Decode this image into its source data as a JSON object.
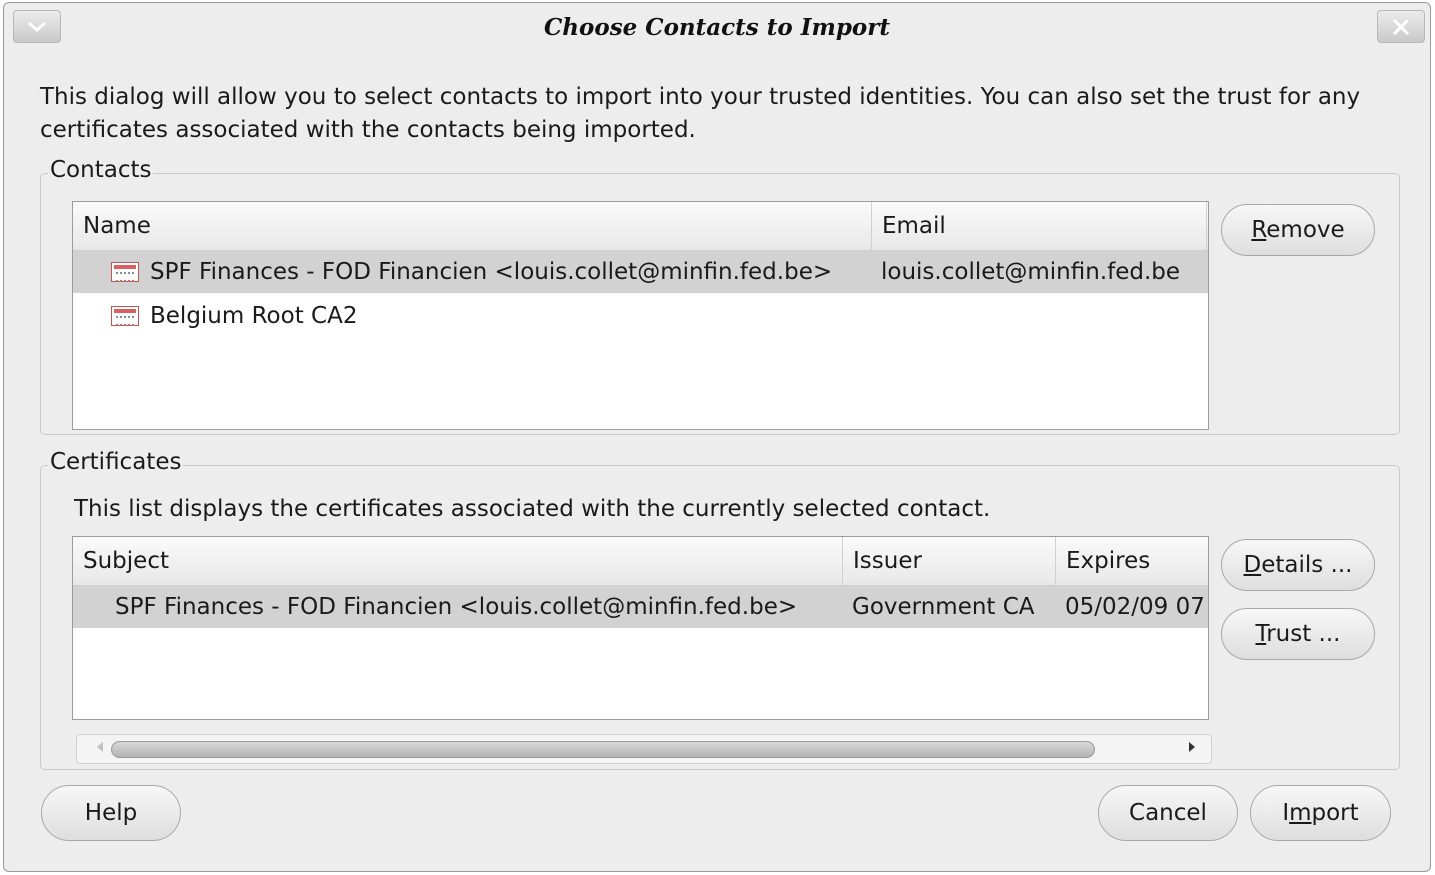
{
  "window": {
    "title": "Choose Contacts to Import"
  },
  "intro": "This dialog will allow you to select contacts to import into your trusted identities. You can also set the trust for any certificates associated with the contacts being imported.",
  "contacts": {
    "group_title": "Contacts",
    "columns": {
      "name": "Name",
      "email": "Email"
    },
    "rows": [
      {
        "name": "SPF Finances - FOD Financien <louis.collet@minfin.fed.be>",
        "email": "louis.collet@minfin.fed.be",
        "selected": true
      },
      {
        "name": "Belgium Root CA2",
        "email": "",
        "selected": false
      }
    ],
    "remove_prefix": "",
    "remove_mnemonic": "R",
    "remove_rest": "emove"
  },
  "certificates": {
    "group_title": "Certificates",
    "description": "This list displays the certificates associated with the currently selected contact.",
    "columns": {
      "subject": "Subject",
      "issuer": "Issuer",
      "expires": "Expires"
    },
    "rows": [
      {
        "subject": "SPF Finances - FOD Financien <louis.collet@minfin.fed.be>",
        "issuer": "Government CA",
        "expires": "05/02/09 07",
        "selected": true
      }
    ],
    "details_mnemonic": "D",
    "details_rest": "etails ...",
    "trust_mnemonic": "T",
    "trust_rest": "rust ..."
  },
  "footer": {
    "help": "Help",
    "cancel": "Cancel",
    "import_prefix": "I",
    "import_mnemonic": "m",
    "import_rest": "port"
  },
  "icons": {
    "window_menu": "chevron-down-icon",
    "close": "close-icon",
    "certificate": "certificate-icon"
  }
}
